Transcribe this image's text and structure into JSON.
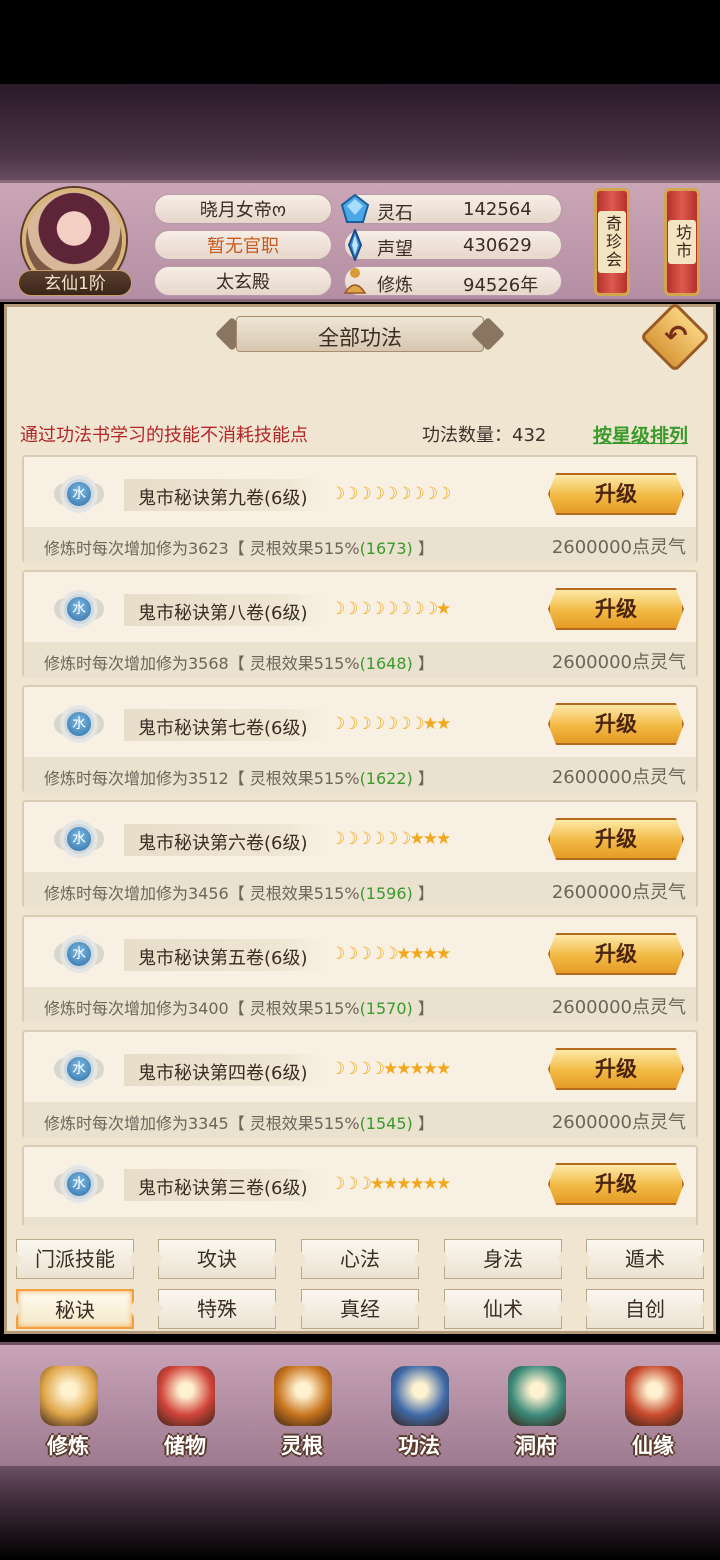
{
  "player": {
    "name": "晓月女帝ო",
    "official": "暂无官职",
    "sect": "太玄殿",
    "rank": "玄仙1阶"
  },
  "resources": [
    {
      "label": "灵石",
      "value": "142564",
      "icon": "spirit-stone-icon"
    },
    {
      "label": "声望",
      "value": "430629",
      "icon": "prestige-crystal-icon"
    },
    {
      "label": "修炼",
      "value": "94526年",
      "icon": "meditation-icon"
    }
  ],
  "side_buttons": {
    "treasure": "奇珍会",
    "market": "坊市"
  },
  "panel": {
    "title": "全部功法",
    "notice": "通过功法书学习的技能不消耗技能点",
    "count_label": "功法数量：432",
    "sort_label": "按星级排列"
  },
  "skills": [
    {
      "element": "水",
      "name": "鬼市秘诀第九卷(6级)",
      "moons": 9,
      "stars": 0,
      "upgrade": "升级",
      "desc_a": "修炼时每次增加修为3623【 灵根效果515%",
      "desc_b": "(1673)",
      "desc_c": " 】",
      "cost": "2600000点灵气"
    },
    {
      "element": "水",
      "name": "鬼市秘诀第八卷(6级)",
      "moons": 8,
      "stars": 1,
      "upgrade": "升级",
      "desc_a": "修炼时每次增加修为3568【 灵根效果515%",
      "desc_b": "(1648)",
      "desc_c": " 】",
      "cost": "2600000点灵气"
    },
    {
      "element": "水",
      "name": "鬼市秘诀第七卷(6级)",
      "moons": 7,
      "stars": 2,
      "upgrade": "升级",
      "desc_a": "修炼时每次增加修为3512【 灵根效果515%",
      "desc_b": "(1622)",
      "desc_c": " 】",
      "cost": "2600000点灵气"
    },
    {
      "element": "水",
      "name": "鬼市秘诀第六卷(6级)",
      "moons": 6,
      "stars": 3,
      "upgrade": "升级",
      "desc_a": "修炼时每次增加修为3456【 灵根效果515%",
      "desc_b": "(1596)",
      "desc_c": " 】",
      "cost": "2600000点灵气"
    },
    {
      "element": "水",
      "name": "鬼市秘诀第五卷(6级)",
      "moons": 5,
      "stars": 4,
      "upgrade": "升级",
      "desc_a": "修炼时每次增加修为3400【 灵根效果515%",
      "desc_b": "(1570)",
      "desc_c": " 】",
      "cost": "2600000点灵气"
    },
    {
      "element": "水",
      "name": "鬼市秘诀第四卷(6级)",
      "moons": 4,
      "stars": 5,
      "upgrade": "升级",
      "desc_a": "修炼时每次增加修为3345【 灵根效果515%",
      "desc_b": "(1545)",
      "desc_c": " 】",
      "cost": "2600000点灵气"
    },
    {
      "element": "水",
      "name": "鬼市秘诀第三卷(6级)",
      "moons": 3,
      "stars": 6,
      "upgrade": "升级",
      "desc_a": "",
      "desc_b": "",
      "desc_c": "",
      "cost": ""
    }
  ],
  "tabs": [
    "门派技能",
    "攻诀",
    "心法",
    "身法",
    "遁术",
    "秘诀",
    "特殊",
    "真经",
    "仙术",
    "自创"
  ],
  "active_tab": "秘诀",
  "nav": [
    {
      "label": "修炼",
      "icon": "cultivation-icon",
      "color": "#e0a64a"
    },
    {
      "label": "储物",
      "icon": "storage-bag-icon",
      "color": "#d0443a"
    },
    {
      "label": "灵根",
      "icon": "spirit-root-icon",
      "color": "#c8741e"
    },
    {
      "label": "功法",
      "icon": "skill-book-icon",
      "color": "#3f6aa8"
    },
    {
      "label": "洞府",
      "icon": "cave-palace-icon",
      "color": "#3c8a7a"
    },
    {
      "label": "仙缘",
      "icon": "immortal-fate-icon",
      "color": "#c84a2e"
    }
  ]
}
